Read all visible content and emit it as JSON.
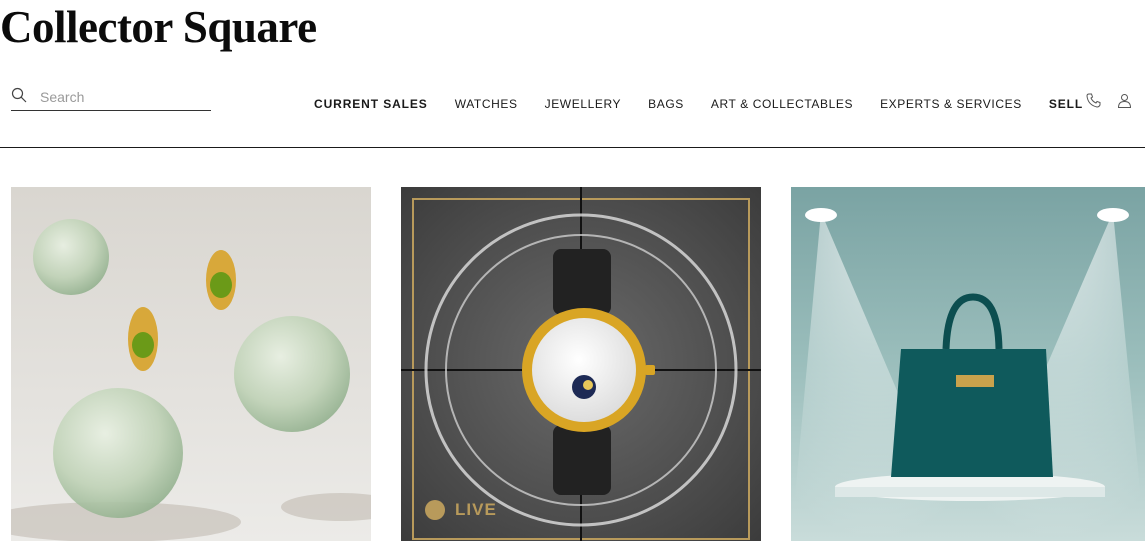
{
  "brand": {
    "name": "Collector Square"
  },
  "search": {
    "placeholder": "Search",
    "icon": "search-icon"
  },
  "nav": {
    "items": [
      {
        "label": "CURRENT SALES",
        "bold": true
      },
      {
        "label": "WATCHES",
        "bold": false
      },
      {
        "label": "JEWELLERY",
        "bold": false
      },
      {
        "label": "BAGS",
        "bold": false
      },
      {
        "label": "ART & COLLECTABLES",
        "bold": false
      },
      {
        "label": "EXPERTS & SERVICES",
        "bold": false
      },
      {
        "label": "SELL",
        "bold": true
      }
    ]
  },
  "tools": {
    "icons": [
      "phone-icon",
      "user-icon"
    ]
  },
  "cards": [
    {
      "subject": "jewellery",
      "image": "earrings-and-glass-spheres"
    },
    {
      "subject": "watches",
      "image": "gold-moonphase-watch",
      "badge": "LIVE"
    },
    {
      "subject": "bags",
      "image": "teal-crocodile-handbag-spotlight"
    }
  ],
  "colors": {
    "gold": "#b89a5b",
    "teal": "#0f5a5c",
    "text": "#1a1a1a"
  }
}
